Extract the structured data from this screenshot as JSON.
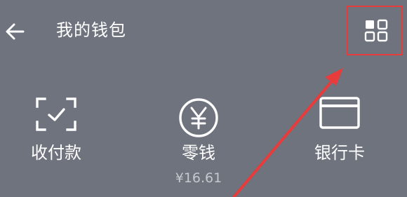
{
  "header": {
    "title": "我的钱包",
    "back_icon": "arrow-left-icon",
    "menu_icon": "grid-icon"
  },
  "actions": [
    {
      "label": "收付款",
      "icon": "scan-check-icon"
    },
    {
      "label": "零钱",
      "sub": "¥16.61",
      "icon": "yen-circle-icon"
    },
    {
      "label": "银行卡",
      "icon": "card-icon"
    }
  ],
  "annotation": {
    "color": "#e83b3b"
  },
  "colors": {
    "background": "#6e737d",
    "foreground": "#ffffff",
    "muted": "#c5c8cd"
  }
}
